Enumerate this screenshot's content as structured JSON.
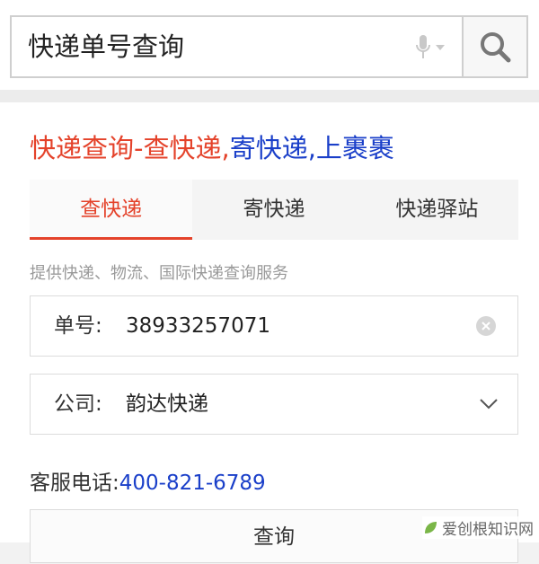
{
  "search": {
    "query": "快递单号查询"
  },
  "card": {
    "title": {
      "part1": "快递查询-查快递",
      "sep1": ",",
      "part2": "寄快递",
      "sep2": ",",
      "part3": "上裹裹"
    },
    "tabs": [
      {
        "label": "查快递",
        "active": true
      },
      {
        "label": "寄快递",
        "active": false
      },
      {
        "label": "快递驿站",
        "active": false
      }
    ],
    "hint": "提供快递、物流、国际快递查询服务",
    "tracking": {
      "label": "单号:",
      "value": "38933257071"
    },
    "company": {
      "label": "公司:",
      "value": "韵达快递"
    },
    "service": {
      "label": "客服电话:",
      "phone": "400-821-6789"
    },
    "query_label": "查询"
  },
  "watermark": "爱创根知识网",
  "colors": {
    "accent_red": "#e4422a",
    "link_blue": "#1a3fc9"
  }
}
